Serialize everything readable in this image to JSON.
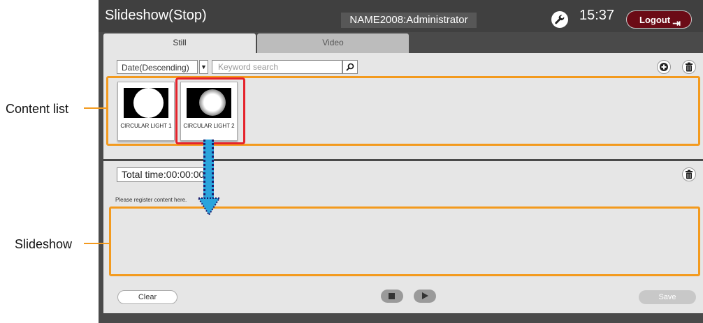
{
  "header": {
    "title": "Slideshow(Stop)",
    "user": "NAME2008:Administrator",
    "time": "15:37",
    "logout_label": "Logout"
  },
  "tabs": [
    {
      "label": "Still",
      "active": true
    },
    {
      "label": "Video",
      "active": false
    }
  ],
  "toolbar": {
    "sort_value": "Date(Descending)",
    "search_placeholder": "Keyword search"
  },
  "content_list": [
    {
      "label": "CIRCULAR LIGHT 1",
      "selected": false
    },
    {
      "label": "CIRCULAR LIGHT 2",
      "selected": true
    }
  ],
  "slideshow": {
    "total_time": "Total time:00:00:00",
    "hint": "Please register content here."
  },
  "footer": {
    "clear_label": "Clear",
    "save_label": "Save"
  },
  "callouts": {
    "content_list": "Content list",
    "slideshow": "Slideshow"
  },
  "colors": {
    "accent_frame": "#f39a1e",
    "selection": "#e5222b",
    "logout_bg": "#6b0b16",
    "drag_arrow": "#2aa4dc"
  },
  "icons": {
    "settings": "wrench-icon",
    "logout": "logout-icon",
    "search": "search-icon",
    "add": "plus-icon",
    "delete": "trash-icon",
    "stop": "stop-icon",
    "play": "play-icon"
  }
}
